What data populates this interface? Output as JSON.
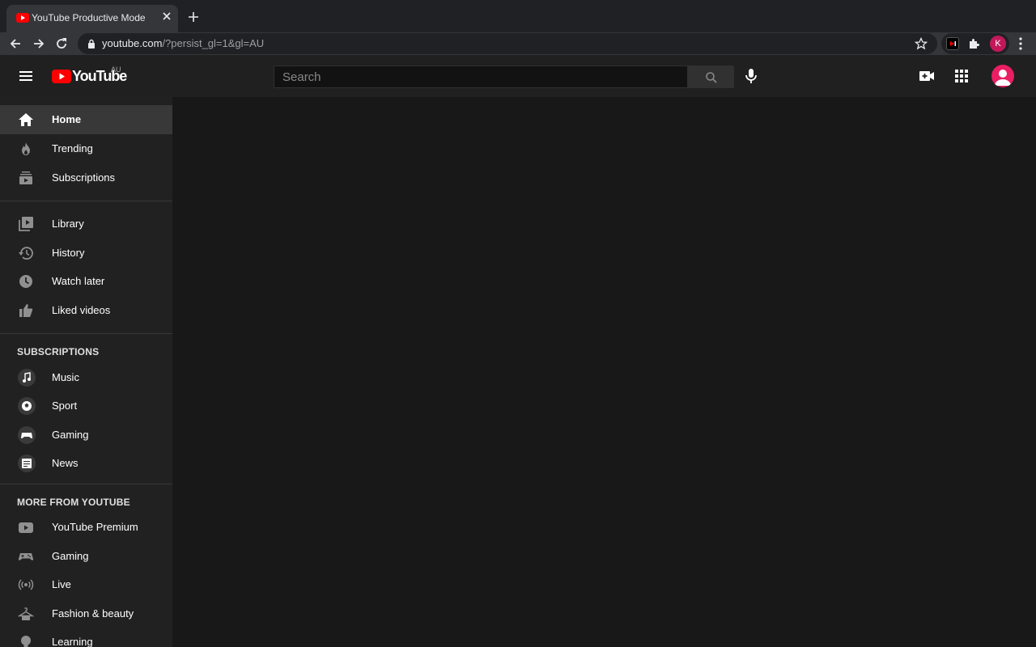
{
  "browser": {
    "tab_title": "YouTube Productive Mode",
    "url_host": "youtube.com",
    "url_path": "/?persist_gl=1&gl=AU",
    "profile_initial": "K"
  },
  "header": {
    "logo_text": "YouTube",
    "country_code": "AU",
    "search_placeholder": "Search"
  },
  "sidebar": {
    "main_items": [
      {
        "label": "Home",
        "icon": "home-icon"
      },
      {
        "label": "Trending",
        "icon": "trending-icon"
      },
      {
        "label": "Subscriptions",
        "icon": "subscriptions-icon"
      }
    ],
    "library_items": [
      {
        "label": "Library",
        "icon": "library-icon"
      },
      {
        "label": "History",
        "icon": "history-icon"
      },
      {
        "label": "Watch later",
        "icon": "watch-later-icon"
      },
      {
        "label": "Liked videos",
        "icon": "liked-icon"
      }
    ],
    "subscriptions_title": "SUBSCRIPTIONS",
    "subscriptions": [
      {
        "label": "Music",
        "icon": "music-icon"
      },
      {
        "label": "Sport",
        "icon": "sport-icon"
      },
      {
        "label": "Gaming",
        "icon": "gaming-icon"
      },
      {
        "label": "News",
        "icon": "news-icon"
      }
    ],
    "more_title": "MORE FROM YOUTUBE",
    "more_items": [
      {
        "label": "YouTube Premium",
        "icon": "youtube-premium-icon"
      },
      {
        "label": "Gaming",
        "icon": "gaming-controller-icon"
      },
      {
        "label": "Live",
        "icon": "live-icon"
      },
      {
        "label": "Fashion & beauty",
        "icon": "hanger-icon"
      },
      {
        "label": "Learning",
        "icon": "lightbulb-icon"
      }
    ]
  },
  "colors": {
    "brand_red": "#ff0000",
    "sidebar_bg": "#212121",
    "main_bg": "#181818"
  }
}
